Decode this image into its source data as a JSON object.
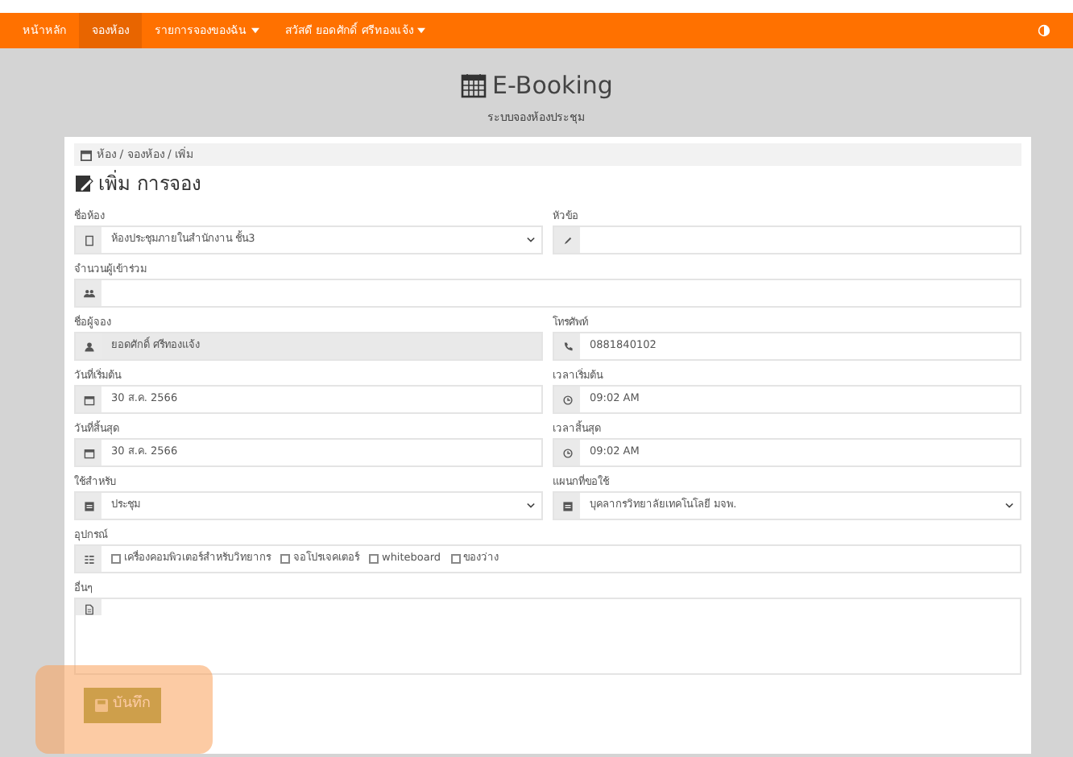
{
  "navbar": {
    "items": [
      {
        "label": "หน้าหลัก",
        "selected": false,
        "dropdown": false
      },
      {
        "label": "จองห้อง",
        "selected": true,
        "dropdown": false
      },
      {
        "label": "รายการจองของฉัน",
        "selected": false,
        "dropdown": true
      },
      {
        "label": "สวัสดี ยอดศักดิ์ ศรีทองแจ้ง",
        "selected": false,
        "dropdown": true
      }
    ]
  },
  "header": {
    "title": "E-Booking",
    "subtitle": "ระบบจองห้องประชุม"
  },
  "breadcrumb": "ห้อง / จองห้อง / เพิ่ม",
  "form": {
    "heading": "เพิ่ม การจอง",
    "rows": [
      {
        "fields": [
          {
            "label": "ชื่อห้อง",
            "kind": "select",
            "value": "ห้องประชุมภายในสำนักงาน ชั้น3",
            "disabled": false
          },
          {
            "label": "หัวข้อ",
            "kind": "input",
            "disabled": false
          }
        ]
      },
      {
        "fields": [
          {
            "label": "จำนวนผู้เข้าร่วม",
            "kind": "input",
            "disabled": false
          }
        ]
      },
      {
        "fields": [
          {
            "label": "ชื่อผู้จอง",
            "kind": "input",
            "value": "ยอดศักดิ์ ศรีทองแจ้ง",
            "disabled": true
          },
          {
            "label": "โทรศัพท์",
            "kind": "input",
            "value": "0881840102",
            "disabled": false
          }
        ]
      },
      {
        "fields": [
          {
            "label": "วันที่เริ่มต้น",
            "kind": "input",
            "value": "30 ส.ค. 2566",
            "disabled": false
          },
          {
            "label": "เวลาเริ่มต้น",
            "kind": "input",
            "value": "09:02 AM",
            "disabled": false
          }
        ]
      },
      {
        "fields": [
          {
            "label": "วันที่สิ้นสุด",
            "kind": "input",
            "value": "30 ส.ค. 2566",
            "disabled": false
          },
          {
            "label": "เวลาสิ้นสุด",
            "kind": "input",
            "value": "09:02 AM",
            "disabled": false
          }
        ]
      },
      {
        "fields": [
          {
            "label": "ใช้สำหรับ",
            "kind": "select",
            "value": "ประชุม",
            "disabled": false
          },
          {
            "label": "แผนกที่ขอใช้",
            "kind": "select",
            "value": "บุคลากรวิทยาลัยเทคโนโลยี มจพ.",
            "disabled": false
          }
        ]
      },
      {
        "fields": [
          {
            "label": "อุปกรณ์",
            "kind": "checkboxes",
            "options": [
              {
                "label": "เครื่องคอมพิวเตอร์สำหรับวิทยากร",
                "checked": false
              },
              {
                "label": "จอโปรเจคเตอร์",
                "checked": false
              },
              {
                "label": "whiteboard",
                "checked": false
              },
              {
                "label": "ของว่าง",
                "checked": false
              }
            ]
          }
        ]
      },
      {
        "fields": [
          {
            "label": "อื่นๆ",
            "kind": "textarea",
            "disabled": false
          }
        ]
      }
    ],
    "save_button": {
      "label": "บันทึก",
      "highlighted": true
    }
  }
}
